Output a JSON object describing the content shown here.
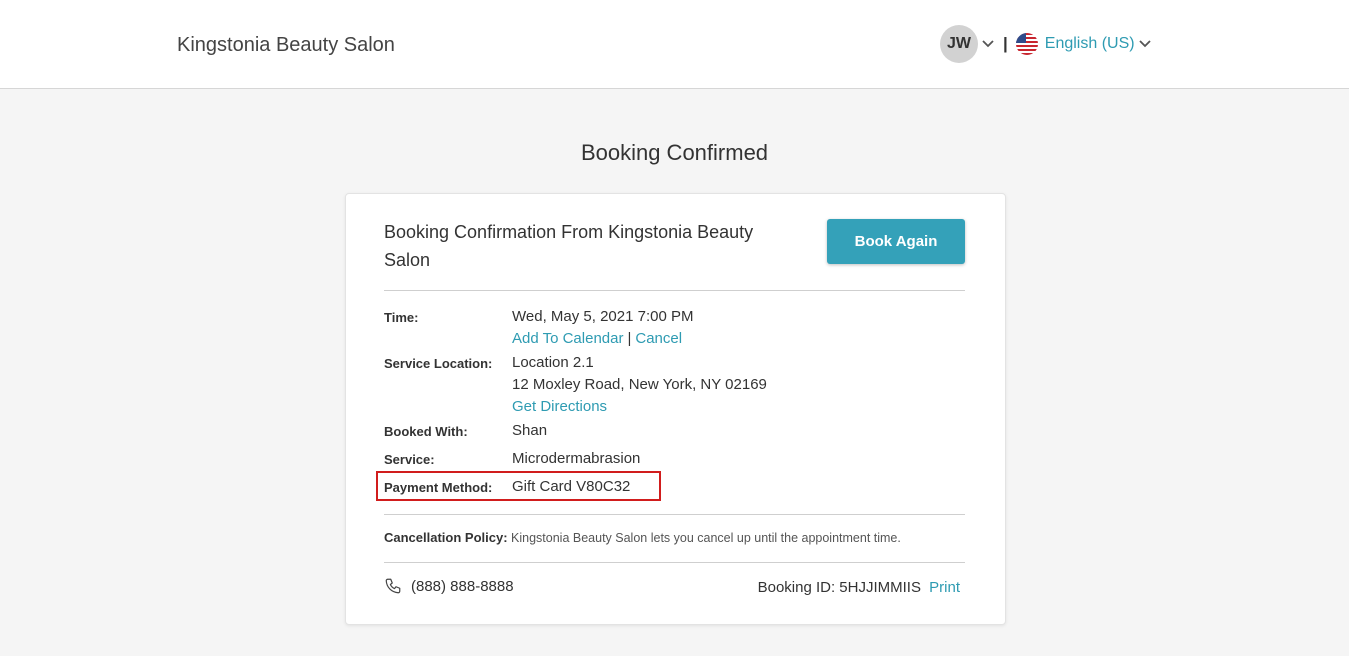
{
  "header": {
    "brand": "Kingstonia Beauty Salon",
    "user_initials": "JW",
    "separator": "|",
    "language": "English (US)"
  },
  "page": {
    "title": "Booking Confirmed"
  },
  "card": {
    "heading": "Booking Confirmation From Kingstonia Beauty Salon",
    "book_again_label": "Book Again",
    "time": {
      "label": "Time:",
      "value": "Wed, May 5, 2021 7:00 PM",
      "add_to_calendar": "Add To Calendar",
      "divider": "|",
      "cancel": "Cancel"
    },
    "location": {
      "label": "Service Location:",
      "name": "Location 2.1",
      "address": "12 Moxley Road, New York, NY 02169",
      "directions": "Get Directions"
    },
    "booked_with": {
      "label": "Booked With:",
      "value": "Shan"
    },
    "service": {
      "label": "Service:",
      "value": "Microdermabrasion"
    },
    "payment": {
      "label": "Payment Method:",
      "value": "Gift Card V80C32"
    },
    "policy": {
      "label": "Cancellation Policy:",
      "text": "Kingstonia Beauty Salon lets you cancel up until the appointment time."
    },
    "footer": {
      "phone": "(888) 888-8888",
      "booking_id": "Booking ID: 5HJJIMMIIS",
      "print": "Print"
    }
  },
  "colors": {
    "accent": "#2e9bb2",
    "button": "#34a1b9",
    "highlight": "#d11d1d"
  },
  "icons": {
    "chevron": "chevron-down-icon",
    "flag": "us-flag-icon",
    "phone": "phone-icon"
  }
}
